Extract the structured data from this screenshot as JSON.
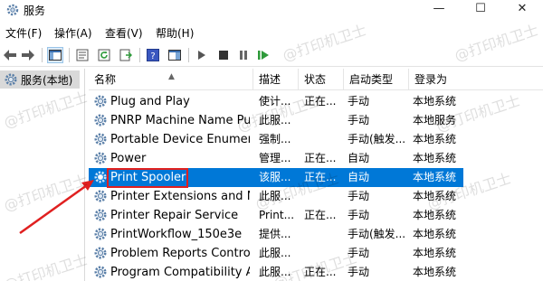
{
  "window": {
    "title": "服务"
  },
  "menu": [
    {
      "label": "文件(F)"
    },
    {
      "label": "操作(A)"
    },
    {
      "label": "查看(V)"
    },
    {
      "label": "帮助(H)"
    }
  ],
  "tree": {
    "root_label": "服务(本地)"
  },
  "columns": [
    "名称",
    "描述",
    "状态",
    "启动类型",
    "登录为"
  ],
  "services": [
    {
      "name": "Plug and Play",
      "desc": "使计...",
      "status": "正在...",
      "startup": "手动",
      "logon": "本地系统"
    },
    {
      "name": "PNRP Machine Name Pu...",
      "desc": "此服...",
      "status": "",
      "startup": "手动",
      "logon": "本地服务"
    },
    {
      "name": "Portable Device Enumera...",
      "desc": "强制...",
      "status": "",
      "startup": "手动(触发...",
      "logon": "本地系统"
    },
    {
      "name": "Power",
      "desc": "管理...",
      "status": "正在...",
      "startup": "自动",
      "logon": "本地系统"
    },
    {
      "name": "Print Spooler",
      "desc": "该服...",
      "status": "正在...",
      "startup": "自动",
      "logon": "本地系统",
      "selected": true
    },
    {
      "name": "Printer Extensions and N...",
      "desc": "此服...",
      "status": "",
      "startup": "手动",
      "logon": "本地系统"
    },
    {
      "name": "Printer Repair Service",
      "desc": "Print...",
      "status": "正在...",
      "startup": "手动",
      "logon": "本地系统"
    },
    {
      "name": "PrintWorkflow_150e3e",
      "desc": "提供...",
      "status": "",
      "startup": "手动(触发...",
      "logon": "本地系统"
    },
    {
      "name": "Problem Reports Control...",
      "desc": "此服...",
      "status": "",
      "startup": "手动",
      "logon": "本地系统"
    },
    {
      "name": "Program Compatibility A...",
      "desc": "此服...",
      "status": "正在...",
      "startup": "手动",
      "logon": "本地系统"
    }
  ],
  "watermark": "@打印机卫士",
  "colors": {
    "selection": "#0078d7",
    "highlight_box": "#e02020",
    "arrow": "#e02020"
  }
}
